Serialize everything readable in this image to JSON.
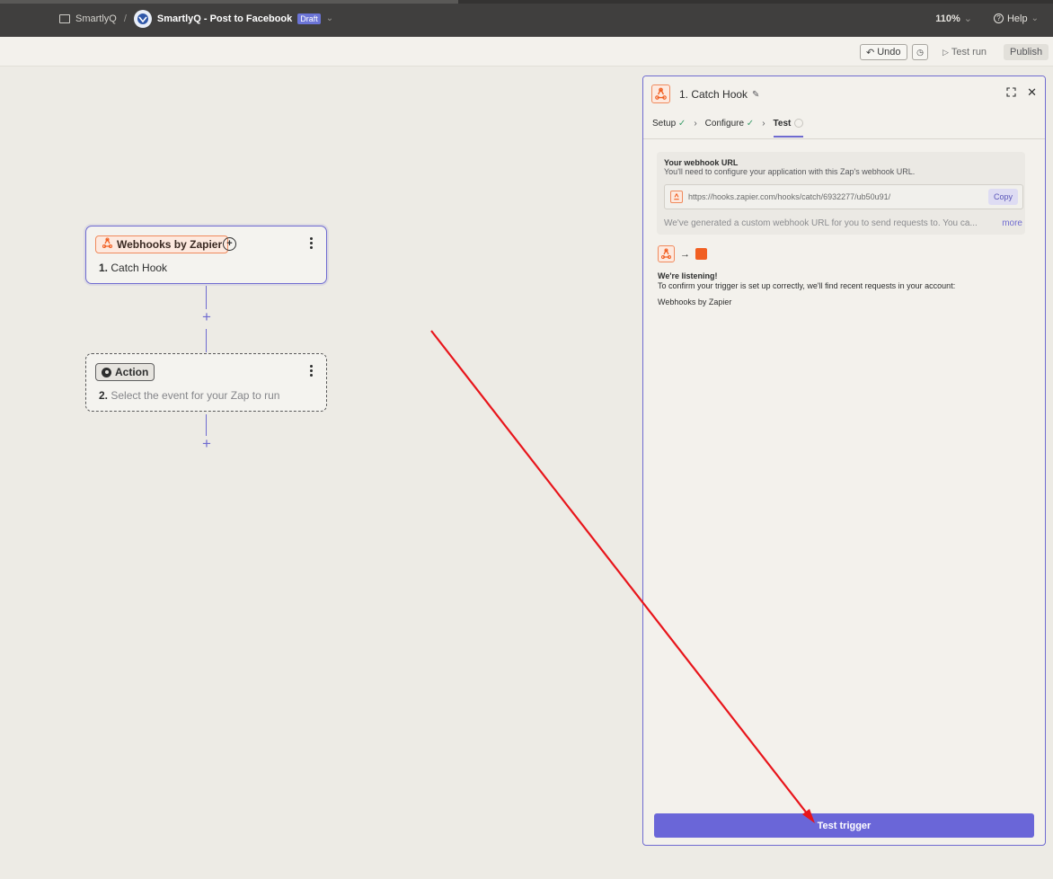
{
  "header": {
    "folder": "SmartlyQ",
    "breadcrumb_sep": "/",
    "zap_name": "SmartlyQ - Post to Facebook",
    "status_badge": "Draft",
    "zoom": "110%",
    "help": "Help"
  },
  "toolbar": {
    "undo_label": "Undo",
    "test_run_label": "Test run",
    "publish_label": "Publish"
  },
  "canvas": {
    "trigger": {
      "app_label": "Webhooks by Zapier",
      "step_number": "1.",
      "step_title": "Catch Hook"
    },
    "action": {
      "app_label": "Action",
      "step_number": "2.",
      "step_title": "Select the event for your Zap to run"
    },
    "add_symbol": "+"
  },
  "panel": {
    "title": "1. Catch Hook",
    "steps": [
      {
        "label": "Setup"
      },
      {
        "label": "Configure"
      },
      {
        "label": "Test"
      }
    ],
    "webhook_heading": "Your webhook URL",
    "webhook_sub": "You'll need to configure your application with this Zap's webhook URL.",
    "webhook_url": "https://hooks.zapier.com/hooks/catch/6932277/ub50u91/",
    "copy_label": "Copy",
    "note": "We've generated a custom webhook URL for you to send requests to. You ca...",
    "more_label": "more",
    "listening_heading": "We're listening!",
    "listening_text": "To confirm your trigger is set up correctly, we'll find recent requests in your account:",
    "listening_app": "Webhooks by Zapier",
    "test_button": "Test trigger"
  },
  "colors": {
    "accent": "#6a66d8",
    "brand_orange": "#f15f22",
    "annotation_red": "#e8151b"
  }
}
